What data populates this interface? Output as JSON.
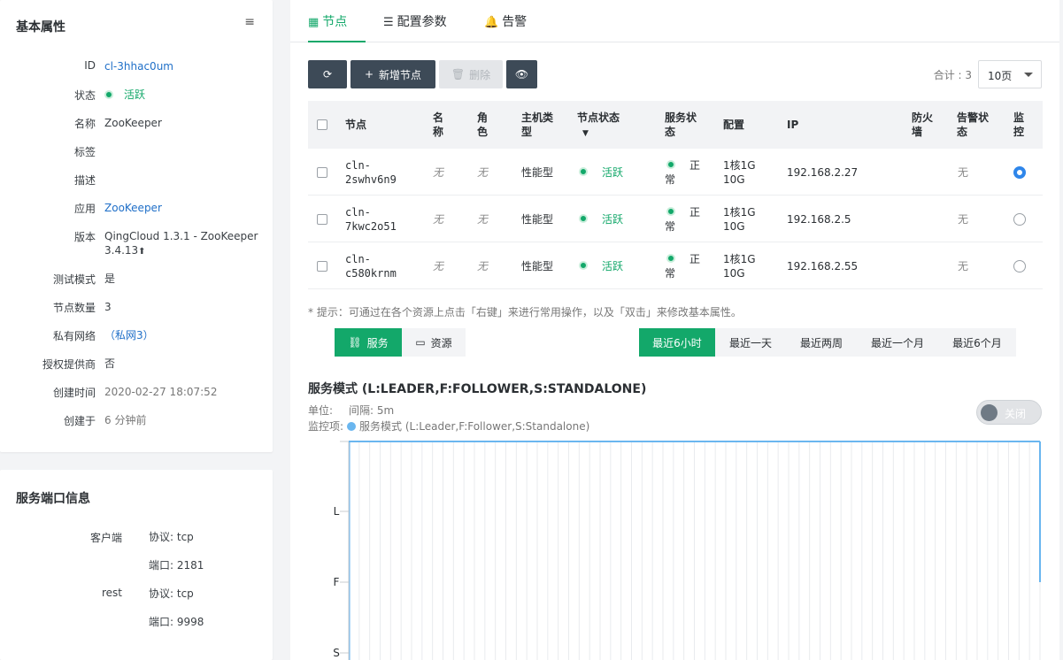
{
  "props": {
    "title": "基本属性",
    "rows": [
      {
        "key": "ID",
        "value": "cl-3hhac0um"
      },
      {
        "key": "状态",
        "value": "活跃"
      },
      {
        "key": "名称",
        "value": "ZooKeeper"
      },
      {
        "key": "标签",
        "value": ""
      },
      {
        "key": "描述",
        "value": ""
      },
      {
        "key": "应用",
        "value": "ZooKeeper"
      },
      {
        "key": "版本",
        "value": "QingCloud 1.3.1 - ZooKeeper 3.4.13"
      },
      {
        "key": "测试模式",
        "value": "是"
      },
      {
        "key": "节点数量",
        "value": "3"
      },
      {
        "key": "私有网络",
        "value": "（私网3）"
      },
      {
        "key": "授权提供商",
        "value": "否"
      },
      {
        "key": "创建时间",
        "value": "2020-02-27 18:07:52"
      },
      {
        "key": "创建于",
        "value": "6 分钟前"
      }
    ]
  },
  "ports": {
    "title": "服务端口信息",
    "client_label": "客户端",
    "client_proto": "协议: tcp",
    "client_port": "端口: 2181",
    "rest_label": "rest",
    "rest_proto": "协议: tcp",
    "rest_port": "端口: 9998"
  },
  "tabs": [
    {
      "label": "节点",
      "icon": "grid-icon"
    },
    {
      "label": "配置参数",
      "icon": "list-icon"
    },
    {
      "label": "告警",
      "icon": "bell-icon"
    }
  ],
  "toolbar": {
    "add_label": "新增节点",
    "delete_label": "删除",
    "total_label": "合计 : 3",
    "page_size": "10页"
  },
  "table": {
    "headers": {
      "node": "节点",
      "name": [
        "名",
        "称"
      ],
      "role": [
        "角",
        "色"
      ],
      "host_type": [
        "主机类",
        "型"
      ],
      "node_status": "节点状态",
      "service_status": [
        "服务状",
        "态"
      ],
      "config": "配置",
      "ip": "IP",
      "firewall": [
        "防火",
        "墙"
      ],
      "alarm": [
        "告警状",
        "态"
      ],
      "monitor": [
        "监",
        "控"
      ]
    },
    "rows": [
      {
        "node": [
          "cln-",
          "2swhv6n9"
        ],
        "name": "无",
        "role": "无",
        "host_type": "性能型",
        "status": "活跃",
        "service": [
          "正",
          "常"
        ],
        "config": [
          "1核1G",
          "10G"
        ],
        "ip": "192.168.2.27",
        "alarm": "无",
        "monitor": true
      },
      {
        "node": [
          "cln-",
          "7kwc2o51"
        ],
        "name": "无",
        "role": "无",
        "host_type": "性能型",
        "status": "活跃",
        "service": [
          "正",
          "常"
        ],
        "config": [
          "1核1G",
          "10G"
        ],
        "ip": "192.168.2.5",
        "alarm": "无",
        "monitor": false
      },
      {
        "node": [
          "cln-",
          "c580krnm"
        ],
        "name": "无",
        "role": "无",
        "host_type": "性能型",
        "status": "活跃",
        "service": [
          "正",
          "常"
        ],
        "config": [
          "1核1G",
          "10G"
        ],
        "ip": "192.168.2.55",
        "alarm": "无",
        "monitor": false
      }
    ]
  },
  "hint": "* 提示：可通过在各个资源上点击「右键」来进行常用操作，以及「双击」来修改基本属性。",
  "monitor": {
    "type_buttons": [
      "服务",
      "资源"
    ],
    "time_buttons": [
      "最近6小时",
      "最近一天",
      "最近两周",
      "最近一个月",
      "最近6个月"
    ],
    "active_time": 0
  },
  "chart_data": {
    "type": "line",
    "title": "服务模式 (L:LEADER,F:FOLLOWER,S:STANDALONE)",
    "unit_label": "单位:",
    "interval_label": "间隔: 5m",
    "series_label": "监控项:",
    "series": [
      {
        "name": "服务模式 (L:Leader,F:Follower,S:Standalone)",
        "values": [
          1,
          1,
          1
        ]
      }
    ],
    "y_categories": [
      "L",
      "F",
      "S"
    ],
    "toggle_label": "关闭",
    "grid": true,
    "series_color": "#6ab6ef"
  }
}
